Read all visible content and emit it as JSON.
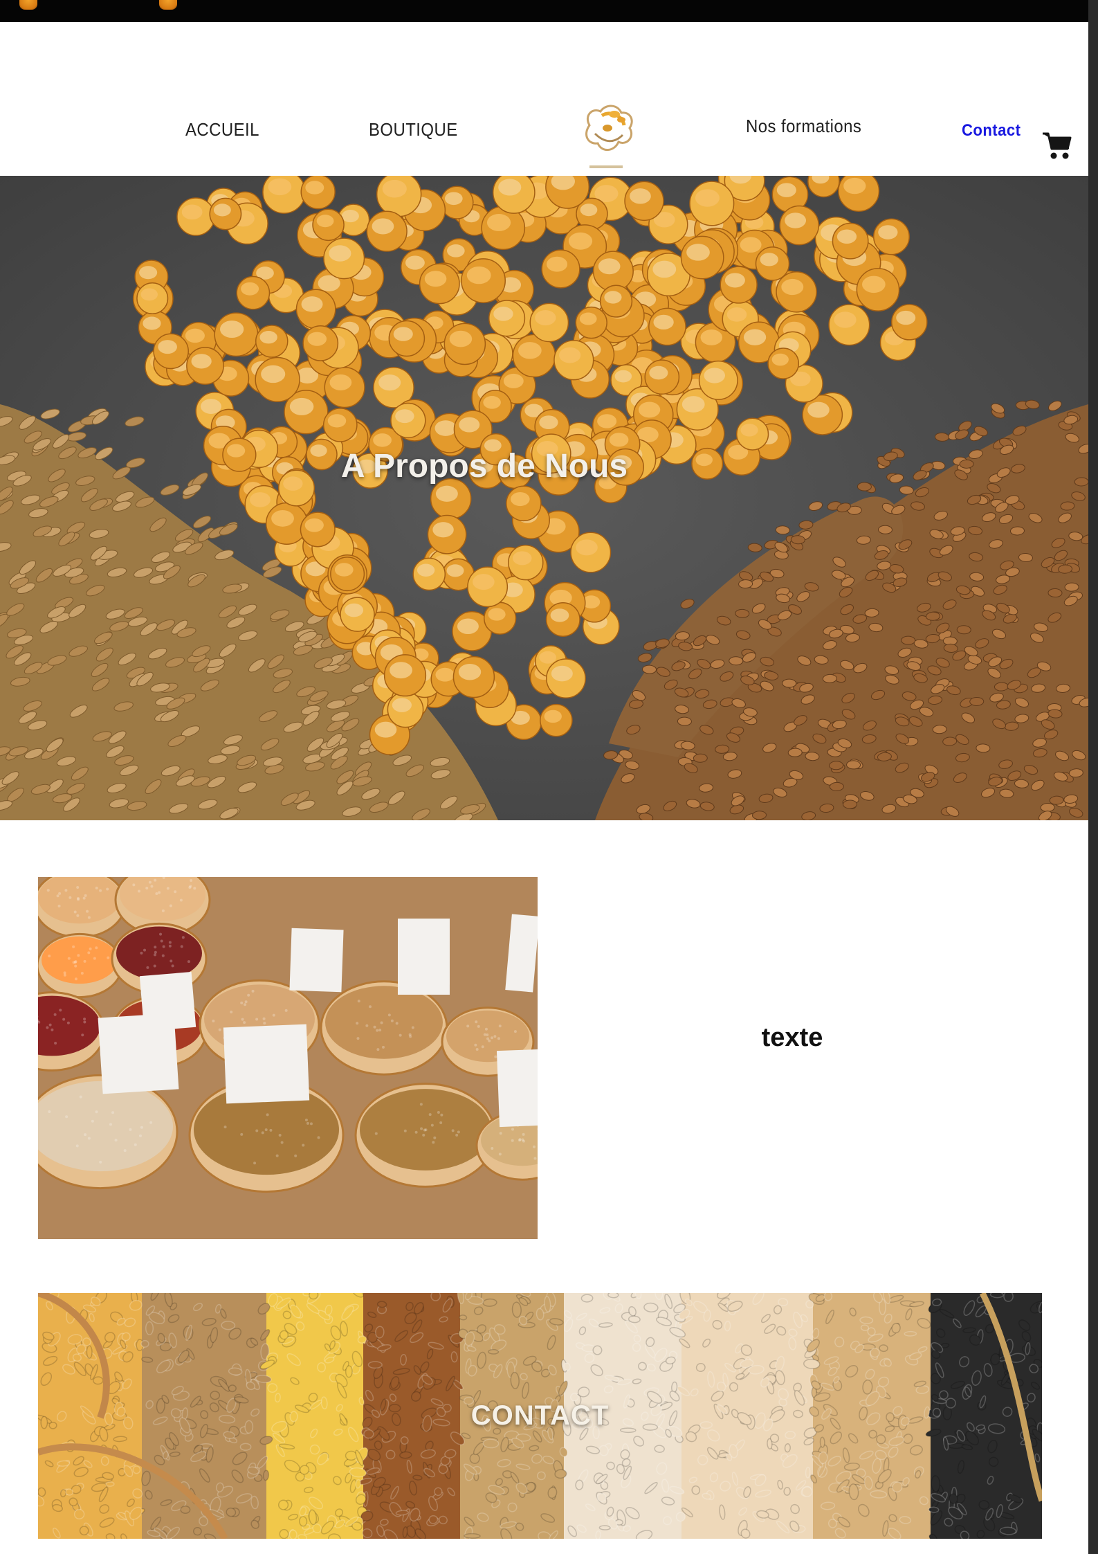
{
  "nav": {
    "links": [
      "ACCUEIL",
      "BOUTIQUE",
      "Nos formations",
      "Contact"
    ],
    "cart_icon": "shopping-cart-icon",
    "logo_icon": "grain-logo-icon"
  },
  "hero": {
    "title": "A Propos de Nous"
  },
  "about": {
    "text": "texte"
  },
  "contact_banner": {
    "title": "CONTACT"
  },
  "colors": {
    "topbar": "#050505",
    "contact_link": "#1818e0",
    "hero_background": "#4a4a4a",
    "corn": "#e0952b",
    "wheat": "#b8864f"
  }
}
